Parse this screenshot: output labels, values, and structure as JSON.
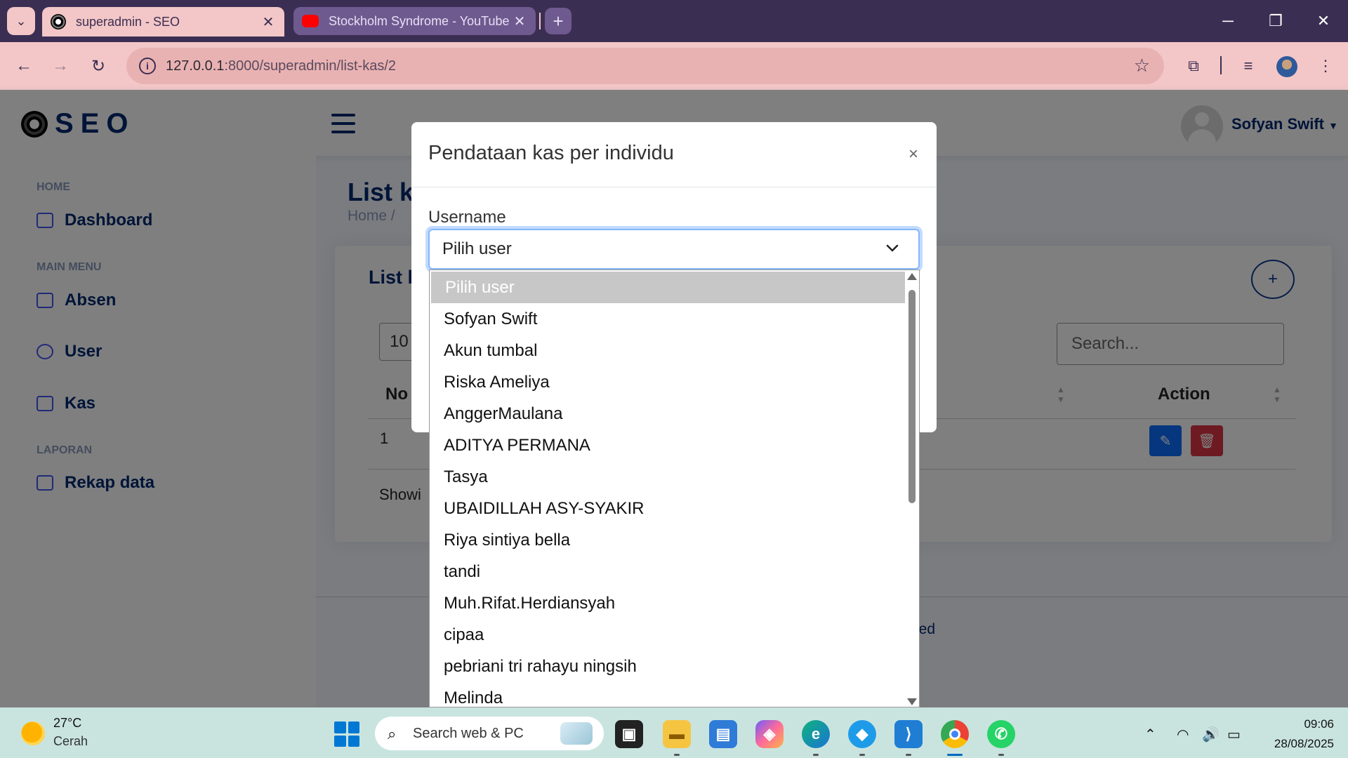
{
  "browser": {
    "tabs": [
      {
        "title": "superadmin - SEO",
        "active": true
      },
      {
        "title": "Stockholm Syndrome - YouTube",
        "active": false
      }
    ],
    "url": "127.0.0.1:8000/superadmin/list-kas/2",
    "url_host": "127.0.0.1",
    "url_path": ":8000/superadmin/list-kas/2"
  },
  "header": {
    "logo_text": "SEO",
    "user_name": "Sofyan Swift"
  },
  "sidebar": {
    "sections": [
      {
        "label": "HOME",
        "items": [
          "Dashboard"
        ]
      },
      {
        "label": "MAIN MENU",
        "items": [
          "Absen",
          "User",
          "Kas"
        ]
      },
      {
        "label": "LAPORAN",
        "items": [
          "Rekap data"
        ]
      }
    ]
  },
  "main": {
    "title": "List k",
    "breadcrumb": "Home  /",
    "card_title": "List k",
    "length_value": "10",
    "search_placeholder": "Search...",
    "col_no": "No",
    "col_action": "Action",
    "row_no": "1",
    "showing": "Showi",
    "footer": "ts Reserved"
  },
  "modal": {
    "title": "Pendataan kas per individu",
    "close": "×",
    "field_label": "Username",
    "select_value": "Pilih user",
    "options": [
      "Pilih user",
      "Sofyan Swift",
      "Akun tumbal",
      "Riska Ameliya",
      "AnggerMaulana",
      "ADITYA PERMANA",
      "Tasya",
      "UBAIDILLAH ASY-SYAKIR",
      "Riya sintiya bella",
      "tandi",
      "Muh.Rifat.Herdiansyah",
      "cipaa",
      "pebriani tri rahayu ningsih",
      "Melinda"
    ]
  },
  "taskbar": {
    "weather_temp": "27°C",
    "weather_desc": "Cerah",
    "search_placeholder": "Search web & PC",
    "time": "09:06",
    "date": "28/08/2025"
  },
  "colors": {
    "tabbar": "#3b2e53",
    "toolbar": "#f3c7c7",
    "brand": "#012970",
    "edit": "#0d6efd",
    "delete": "#dc3545"
  }
}
